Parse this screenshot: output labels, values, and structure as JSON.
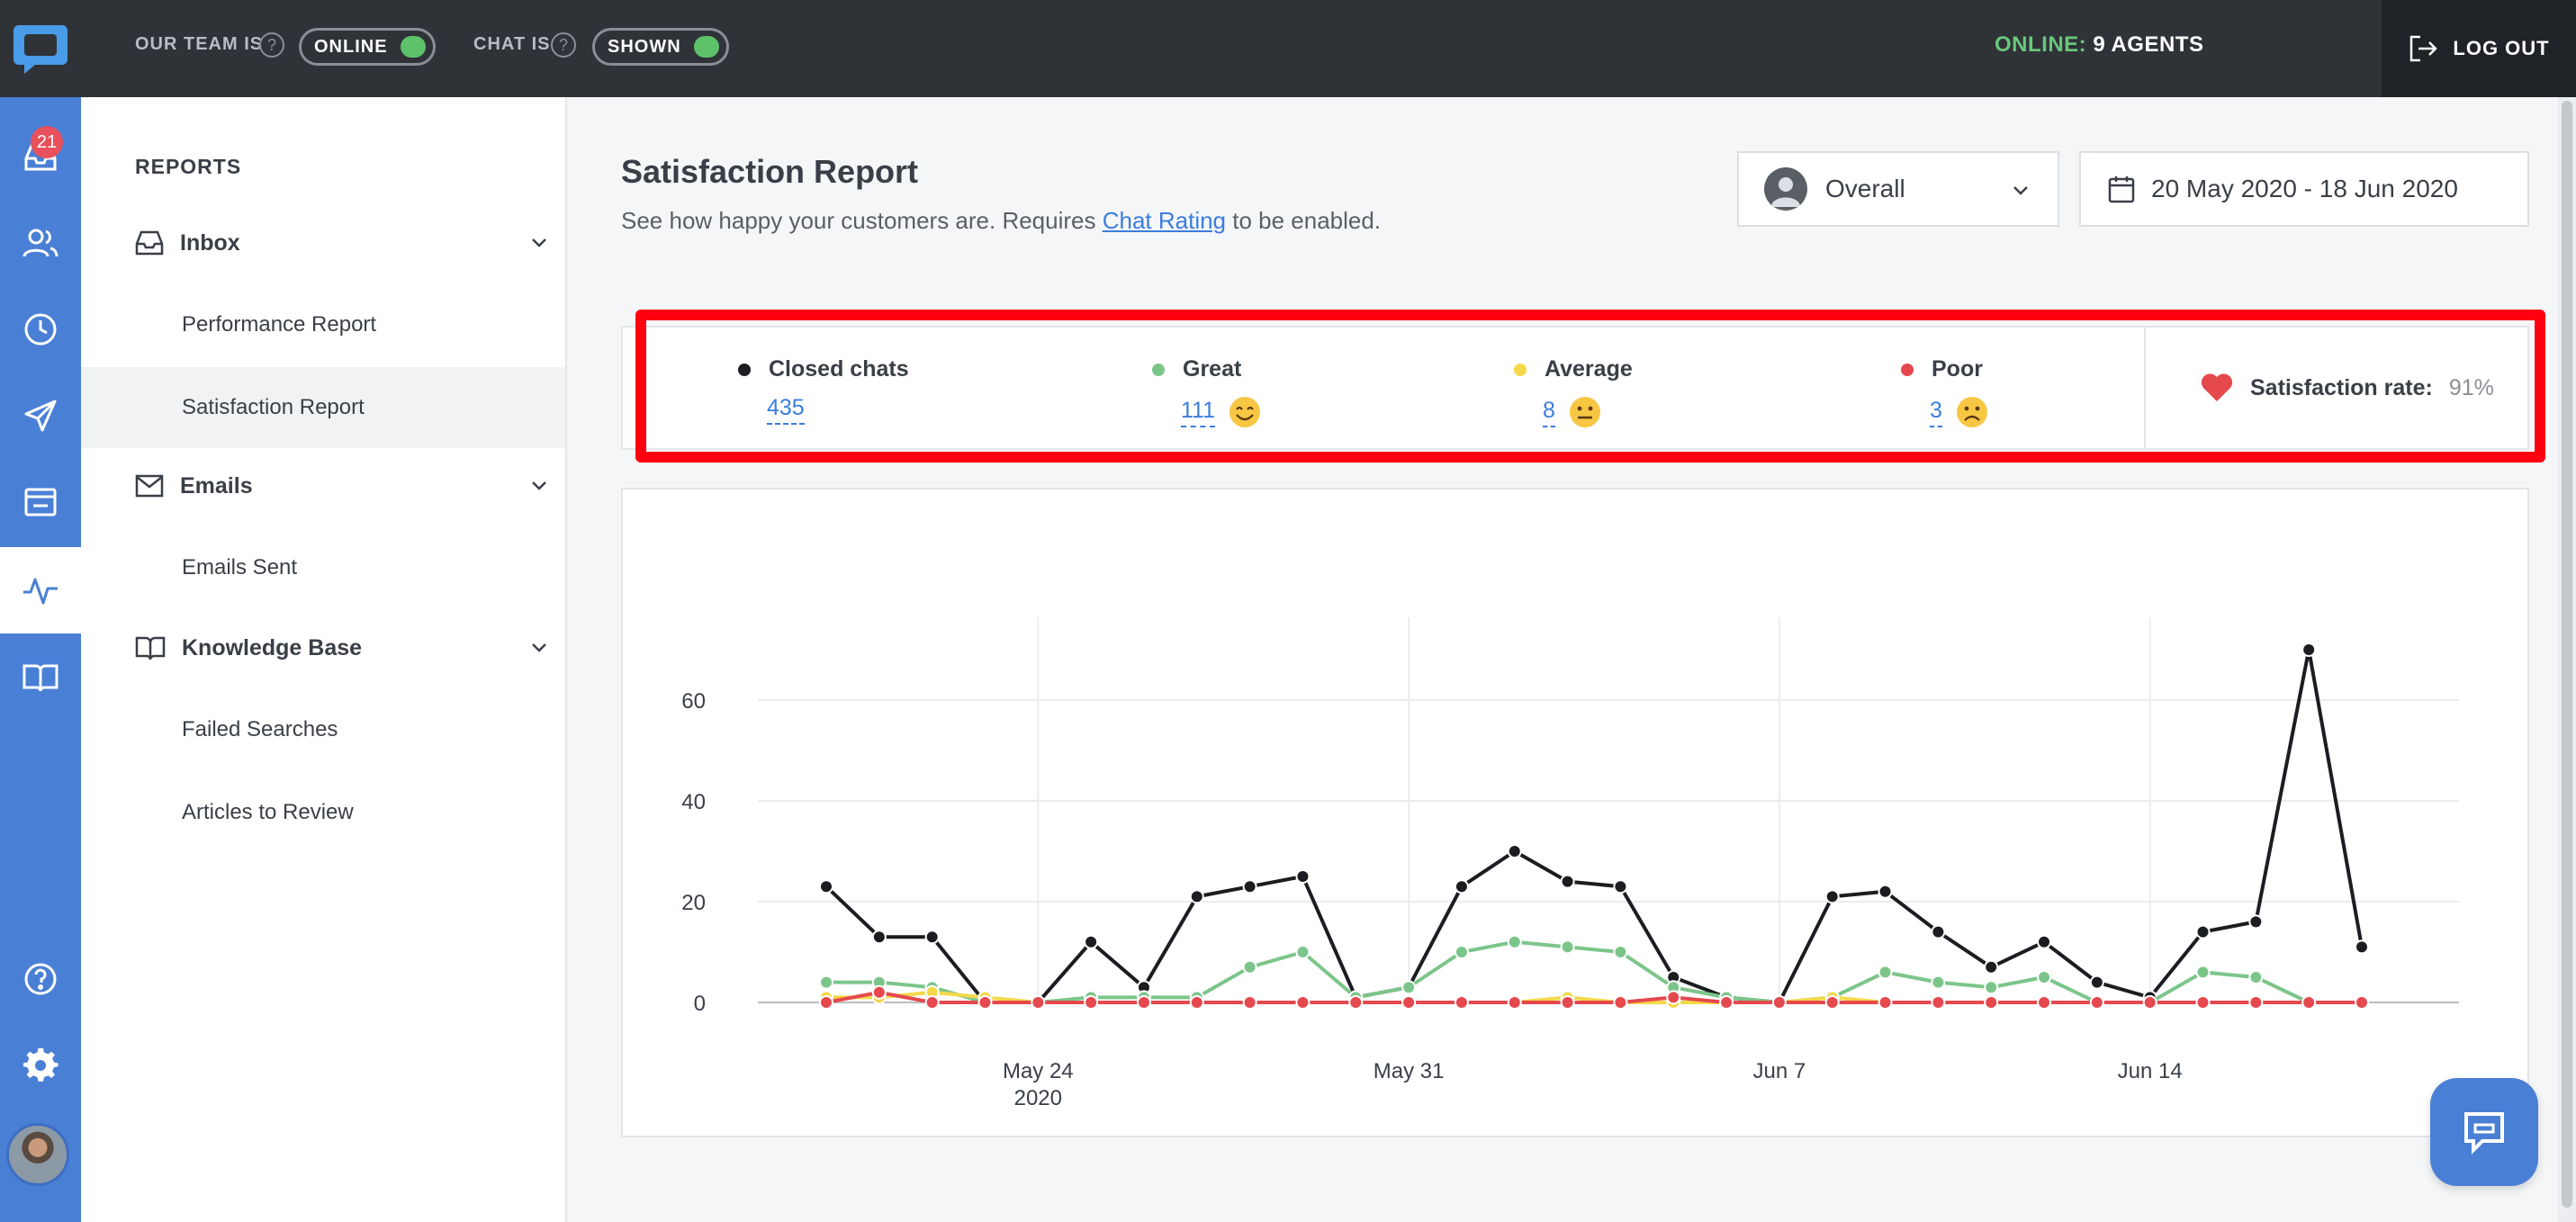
{
  "topbar": {
    "team_label": "OUR TEAM IS",
    "team_toggle": "ONLINE",
    "chat_label": "CHAT IS",
    "chat_toggle": "SHOWN",
    "online_prefix": "ONLINE:",
    "online_count": "9 AGENTS",
    "logout": "LOG OUT"
  },
  "rail": {
    "inbox_badge": "21"
  },
  "nav": {
    "title": "REPORTS",
    "groups": [
      {
        "label": "Inbox",
        "items": [
          "Performance Report",
          "Satisfaction Report"
        ]
      },
      {
        "label": "Emails",
        "items": [
          "Emails Sent"
        ]
      },
      {
        "label": "Knowledge Base",
        "items": [
          "Failed Searches",
          "Articles to Review"
        ]
      }
    ]
  },
  "main": {
    "title": "Satisfaction Report",
    "subtitle_pre": "See how happy your customers are. Requires ",
    "subtitle_link": "Chat Rating",
    "subtitle_post": " to be enabled.",
    "filter": "Overall",
    "date_range": "20 May 2020 - 18 Jun 2020"
  },
  "stats": {
    "closed": {
      "label": "Closed chats",
      "value": "435"
    },
    "great": {
      "label": "Great",
      "value": "111"
    },
    "average": {
      "label": "Average",
      "value": "8"
    },
    "poor": {
      "label": "Poor",
      "value": "3"
    },
    "satisfaction_label": "Satisfaction rate:",
    "satisfaction_value": "91%"
  },
  "colors": {
    "closed": "#1b1d21",
    "great": "#7cc58a",
    "average": "#f4d84a",
    "poor": "#e5484d",
    "accent": "#4a7fd6"
  },
  "chart_data": {
    "type": "line",
    "x": [
      "2020-05-20",
      "2020-05-21",
      "2020-05-22",
      "2020-05-23",
      "2020-05-24",
      "2020-05-25",
      "2020-05-26",
      "2020-05-27",
      "2020-05-28",
      "2020-05-29",
      "2020-05-30",
      "2020-05-31",
      "2020-06-01",
      "2020-06-02",
      "2020-06-03",
      "2020-06-04",
      "2020-06-05",
      "2020-06-06",
      "2020-06-07",
      "2020-06-08",
      "2020-06-09",
      "2020-06-10",
      "2020-06-11",
      "2020-06-12",
      "2020-06-13",
      "2020-06-14",
      "2020-06-15",
      "2020-06-16",
      "2020-06-17",
      "2020-06-18"
    ],
    "xticks": [
      {
        "date": "2020-05-24",
        "label": "May 24",
        "sub": "2020"
      },
      {
        "date": "2020-05-31",
        "label": "May 31",
        "sub": ""
      },
      {
        "date": "2020-06-07",
        "label": "Jun 7",
        "sub": ""
      },
      {
        "date": "2020-06-14",
        "label": "Jun 14",
        "sub": ""
      }
    ],
    "yticks": [
      0,
      20,
      40,
      60
    ],
    "ylim": [
      0,
      75
    ],
    "series": [
      {
        "name": "Closed chats",
        "values": [
          23,
          13,
          13,
          0,
          0,
          12,
          3,
          21,
          23,
          25,
          1,
          3,
          23,
          30,
          24,
          23,
          5,
          1,
          0,
          21,
          22,
          14,
          7,
          12,
          4,
          1,
          14,
          16,
          70,
          11
        ]
      },
      {
        "name": "Great",
        "values": [
          4,
          4,
          3,
          0,
          0,
          1,
          1,
          1,
          7,
          10,
          1,
          3,
          10,
          12,
          11,
          10,
          3,
          1,
          0,
          1,
          6,
          4,
          3,
          5,
          0,
          0,
          6,
          5,
          0,
          0
        ]
      },
      {
        "name": "Average",
        "values": [
          1,
          1,
          2,
          1,
          0,
          0,
          0,
          0,
          0,
          0,
          0,
          0,
          0,
          0,
          1,
          0,
          0,
          0,
          0,
          1,
          0,
          0,
          0,
          0,
          0,
          0,
          0,
          0,
          0,
          0
        ]
      },
      {
        "name": "Poor",
        "values": [
          0,
          2,
          0,
          0,
          0,
          0,
          0,
          0,
          0,
          0,
          0,
          0,
          0,
          0,
          0,
          0,
          1,
          0,
          0,
          0,
          0,
          0,
          0,
          0,
          0,
          0,
          0,
          0,
          0,
          0
        ]
      }
    ]
  }
}
